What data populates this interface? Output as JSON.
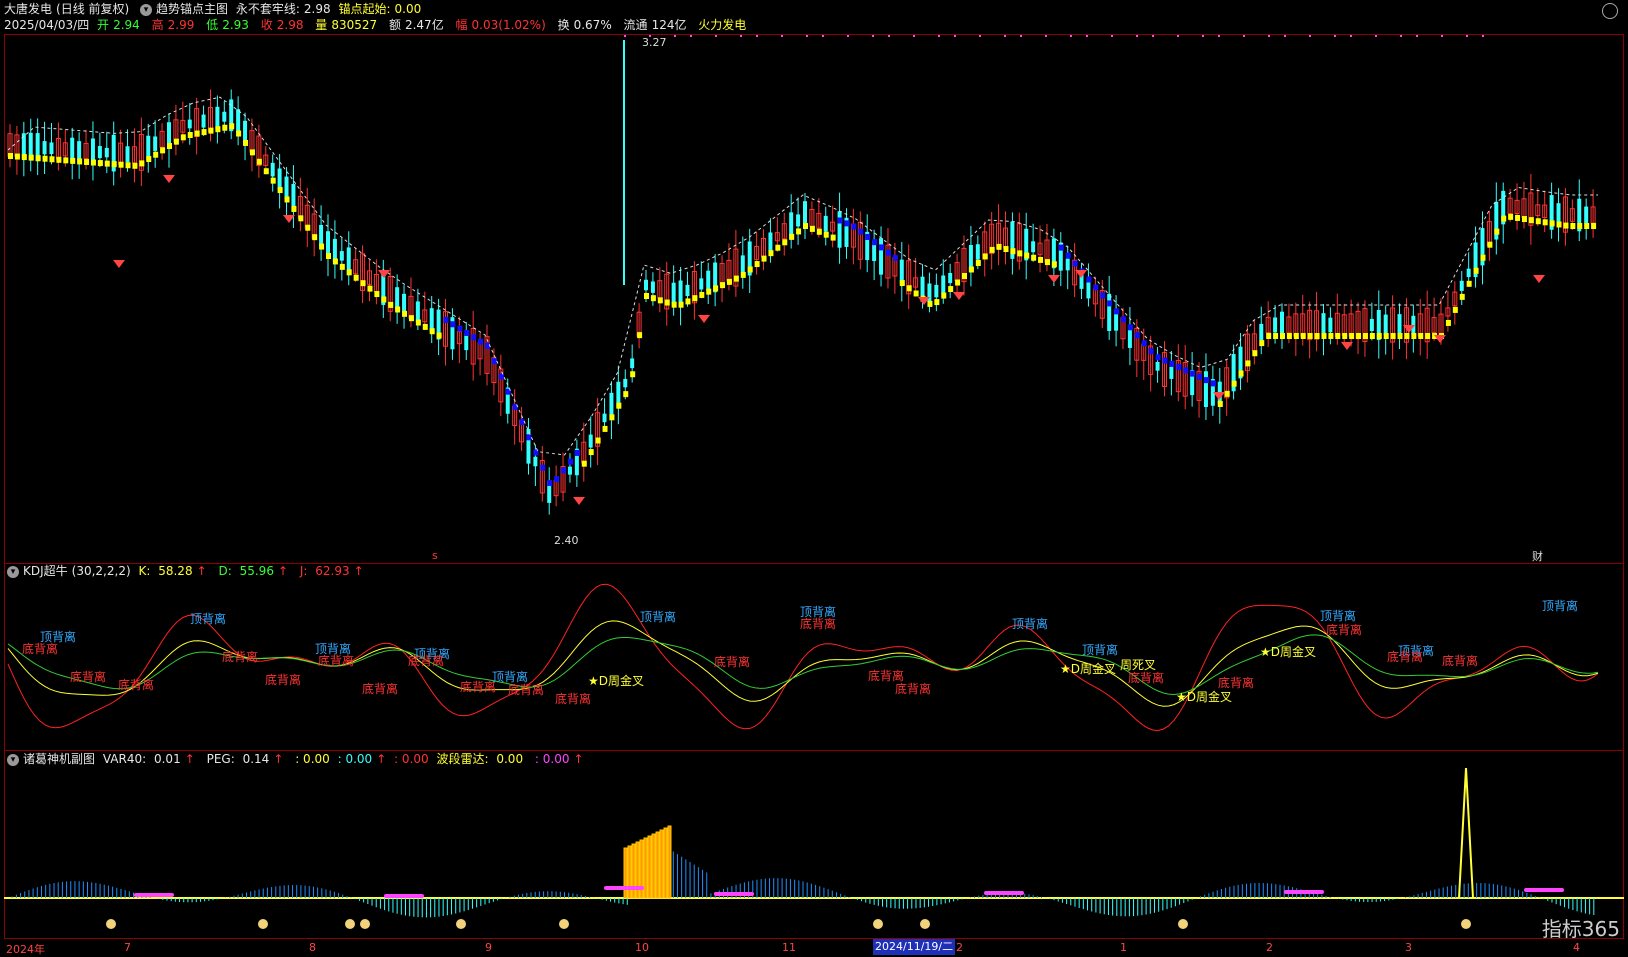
{
  "header": {
    "stock_name": "大唐发电",
    "period": "(日线 前复权)",
    "indicator_name": "趋势锚点主图",
    "line1_label": "永不套牢线:",
    "line1_value": "2.98",
    "line2_label": "锚点起始:",
    "line2_value": "0.00"
  },
  "quote": {
    "date": "2025/04/03/四",
    "open_label": "开",
    "open": "2.94",
    "high_label": "高",
    "high": "2.99",
    "low_label": "低",
    "low": "2.93",
    "close_label": "收",
    "close": "2.98",
    "volume_label": "量",
    "volume": "830527",
    "amount_label": "额",
    "amount": "2.47亿",
    "change_label": "幅",
    "change": "0.03(1.02%)",
    "turnover_label": "换",
    "turnover": "0.67%",
    "float_label": "流通",
    "float": "124亿",
    "concept": "火力发电"
  },
  "main_chart": {
    "max_price_label": "3.27",
    "min_price_label": "2.40",
    "marker_s": "s",
    "marker_cai": "财"
  },
  "kdj": {
    "name": "KDJ超牛",
    "params": "(30,2,2,2)",
    "k_label": "K:",
    "k": "58.28",
    "d_label": "D:",
    "d": "55.96",
    "j_label": "J:",
    "j": "62.93",
    "arrow": "↑",
    "annotations": [
      {
        "text": "顶背离",
        "color": "#33aaff"
      },
      {
        "text": "底背离",
        "color": "#ff3333"
      },
      {
        "text": "★D周金叉",
        "color": "#ffff33"
      },
      {
        "text": "周死叉",
        "color": "#ffff33"
      }
    ]
  },
  "sub": {
    "name": "诸葛神机副图",
    "var40_label": "VAR40:",
    "var40": "0.01",
    "peg_label": "PEG:",
    "peg": "0.14",
    "v1": ": 0.00",
    "v2": ": 0.00",
    "v3": ": 0.00",
    "radar_label": "波段雷达:",
    "radar": "0.00",
    "radar2": "0.00",
    "arrow": "↑"
  },
  "xaxis": {
    "labels": [
      "2024年",
      "7",
      "8",
      "9",
      "10",
      "11",
      "2",
      "1",
      "2",
      "3",
      "4"
    ],
    "cursor_date": "2024/11/19/二"
  },
  "brand": "指标365",
  "colors": {
    "bg": "#000000",
    "up": "#ff3333",
    "down": "#33ffff",
    "trend_up": "#ffff00",
    "trend_down": "#1010ff",
    "border": "#8b0000"
  }
}
